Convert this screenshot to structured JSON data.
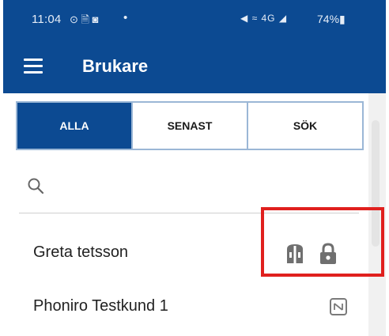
{
  "status_bar": {
    "time": "11:04",
    "left_icons": "⊙ 🗎 ◙",
    "dot": "•",
    "right_icons": "◀ ≈ 4G ◢",
    "battery": "74%▮"
  },
  "app_bar": {
    "title": "Brukare",
    "menu_icon": "hamburger-menu-icon",
    "background_color": "#0c4a92"
  },
  "tabs": [
    {
      "label": "ALLA",
      "active": true
    },
    {
      "label": "SENAST",
      "active": false
    },
    {
      "label": "SÖK",
      "active": false
    }
  ],
  "search": {
    "placeholder": "",
    "value": "",
    "icon": "search-icon"
  },
  "clients": [
    {
      "name": "Greta tetsson",
      "icons": [
        "key-tag-icon",
        "lock-icon"
      ]
    },
    {
      "name": "Phoniro Testkund 1",
      "icons": [
        "nfc-icon"
      ]
    }
  ],
  "annotation": {
    "color": "#e0201e"
  }
}
